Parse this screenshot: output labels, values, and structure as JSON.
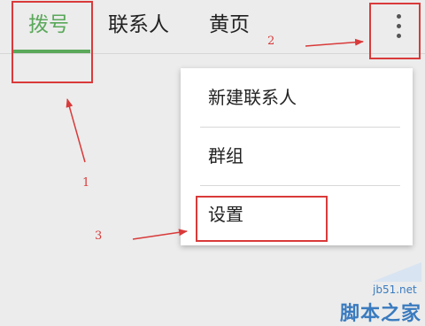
{
  "tabs": [
    {
      "label": "拨号",
      "active": true
    },
    {
      "label": "联系人",
      "active": false
    },
    {
      "label": "黄页",
      "active": false
    }
  ],
  "overflow_menu": {
    "icon": "more-vert-icon",
    "items": [
      {
        "label": "新建联系人"
      },
      {
        "label": "群组"
      },
      {
        "label": "设置"
      }
    ]
  },
  "annotations": {
    "numbers": [
      "1",
      "2",
      "3"
    ],
    "color": "#d93a3a"
  },
  "watermark": {
    "site": "jb51.net",
    "name": "脚本之家"
  },
  "colors": {
    "accent": "#5aa85a",
    "background": "#ececec",
    "menu_bg": "#ffffff"
  }
}
